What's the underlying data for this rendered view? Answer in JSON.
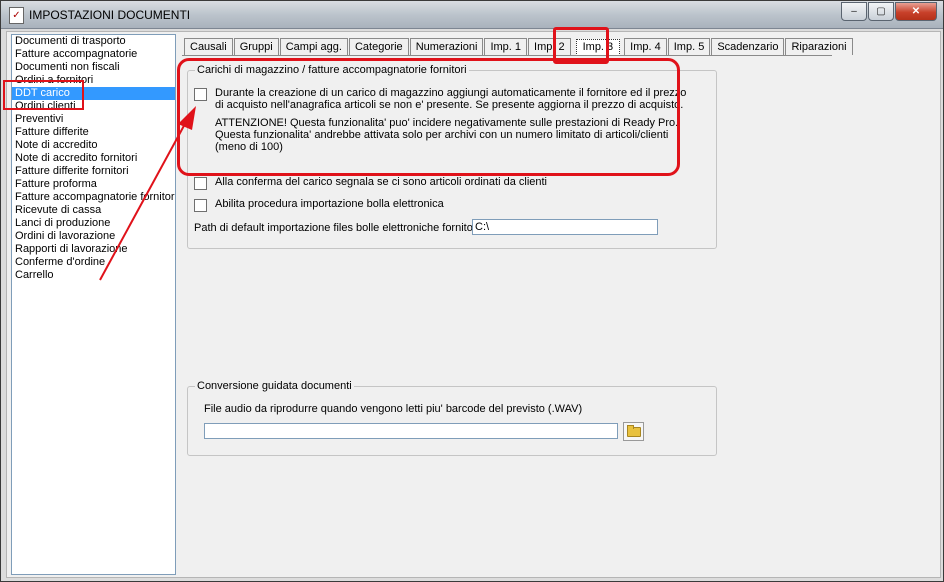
{
  "window": {
    "title": "IMPOSTAZIONI DOCUMENTI",
    "minimize_label": "‒",
    "maximize_label": "▢",
    "close_label": "✕"
  },
  "sidebar": {
    "items": [
      {
        "label": "Documenti di trasporto"
      },
      {
        "label": "Fatture accompagnatorie"
      },
      {
        "label": "Documenti non fiscali"
      },
      {
        "label": "Ordini a fornitori"
      },
      {
        "label": "DDT carico",
        "selected": true
      },
      {
        "label": "Ordini clienti"
      },
      {
        "label": "Preventivi"
      },
      {
        "label": "Fatture differite"
      },
      {
        "label": "Note di accredito"
      },
      {
        "label": "Note di accredito fornitori"
      },
      {
        "label": "Fatture differite fornitori"
      },
      {
        "label": "Fatture proforma"
      },
      {
        "label": "Fatture accompagnatorie fornitori"
      },
      {
        "label": "Ricevute di cassa"
      },
      {
        "label": "Lanci di produzione"
      },
      {
        "label": "Ordini di lavorazione"
      },
      {
        "label": "Rapporti di lavorazione"
      },
      {
        "label": "Conferme d'ordine"
      },
      {
        "label": "Carrello"
      }
    ]
  },
  "tabs": [
    {
      "label": "Causali"
    },
    {
      "label": "Gruppi"
    },
    {
      "label": "Campi agg."
    },
    {
      "label": "Categorie"
    },
    {
      "label": "Numerazioni"
    },
    {
      "label": "Imp. 1"
    },
    {
      "label": "Imp. 2"
    },
    {
      "label": "Imp. 3",
      "active": true
    },
    {
      "label": "Imp. 4"
    },
    {
      "label": "Imp. 5"
    },
    {
      "label": "Scadenzario"
    },
    {
      "label": "Riparazioni"
    }
  ],
  "carichi_group": {
    "title": "Carichi di magazzino / fatture accompagnatorie fornitori",
    "option1_line1": "Durante la creazione di un carico di magazzino aggiungi automaticamente il fornitore ed il prezzo",
    "option1_line2": "di acquisto nell'anagrafica articoli se non e' presente. Se presente aggiorna il prezzo di acquisto.",
    "warning_line1": "ATTENZIONE! Questa funzionalita' puo' incidere negativamente sulle prestazioni di Ready Pro.",
    "warning_line2": "Questa funzionalita' andrebbe attivata solo per archivi con un numero limitato di articoli/clienti",
    "warning_line3": "(meno di 100)",
    "option2": "Alla conferma del carico segnala se ci sono articoli ordinati da clienti",
    "option3": "Abilita procedura importazione bolla elettronica",
    "path_label": "Path di default importazione files bolle elettroniche fornitori",
    "path_value": "C:\\"
  },
  "conversione_group": {
    "title": "Conversione guidata documenti",
    "audio_label": "File audio da riprodurre quando vengono letti piu' barcode del previsto  (.WAV)",
    "audio_value": ""
  },
  "colors": {
    "annotation": "#e0121a",
    "selection": "#3399ff"
  }
}
